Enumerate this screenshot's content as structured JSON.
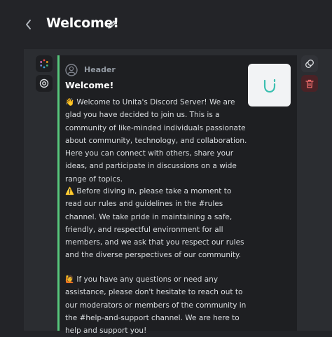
{
  "header": {
    "title": "Welcome!"
  },
  "embed": {
    "header_label": "Header",
    "title": "Welcome!",
    "paragraphs": [
      "👋  Welcome to Unita's Discord Server! We are glad you have decided to join us. This is a community of like-minded individuals passionate about community, technology, and collaboration. Here you can connect with others, share your ideas, and participate in discussions on a wide range of topics.",
      "⚠️  Before diving in, please take a moment to read our rules and guidelines in the #rules channel. We take pride in maintaining a safe, friendly, and respectful environment for all members, and we ask that you respect our rules and the diverse perspectives of our community.",
      "🙋 If you have any questions or need any assistance, please don't hesitate to reach out to our moderators or members of the community in the #help-and-support channel. We are here to help and support you!"
    ],
    "accent_color": "#57c77c"
  },
  "icons": {
    "back": "chevron-left-icon",
    "edit": "pencil-icon",
    "color_picker": "color-wheel-icon",
    "preview": "eye-icon",
    "duplicate": "duplicate-icon",
    "delete": "trash-icon"
  },
  "colors": {
    "background": "#232428",
    "panel": "#2b2d31",
    "card": "#1e1f22",
    "delete_button": "#4a2226",
    "delete_icon": "#f26e6e",
    "logo": "#3bbfb0"
  }
}
